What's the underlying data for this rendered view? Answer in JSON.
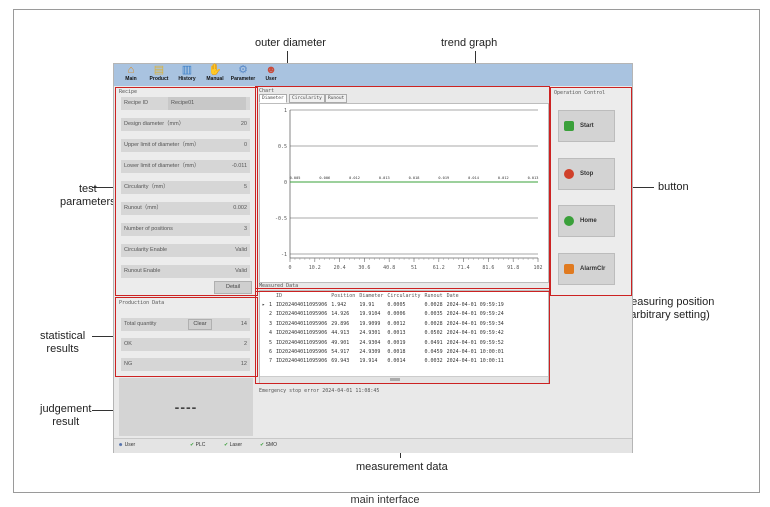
{
  "caption": "main interface",
  "callouts": {
    "outer_diameter": "outer diameter",
    "trend_graph": "trend graph",
    "test_parameters": [
      "test",
      "parameters"
    ],
    "button": "button",
    "measuring_position": [
      "measuring position",
      "(arbitrary setting)"
    ],
    "statistical_results": [
      "statistical",
      "results"
    ],
    "judgement_result": [
      "judgement",
      "result"
    ],
    "measurement_data": "measurement data"
  },
  "toolbar": {
    "items": [
      {
        "label": "Main",
        "icon": "home-icon",
        "glyph": "⌂",
        "color": "#d98a1c"
      },
      {
        "label": "Product",
        "icon": "product-icon",
        "glyph": "▤",
        "color": "#d9b23a"
      },
      {
        "label": "History",
        "icon": "history-icon",
        "glyph": "▥",
        "color": "#3a7fc8"
      },
      {
        "label": "Manual",
        "icon": "manual-icon",
        "glyph": "✋",
        "color": "#c8503a"
      },
      {
        "label": "Parameter",
        "icon": "parameter-icon",
        "glyph": "⚙",
        "color": "#5a8ac8"
      },
      {
        "label": "User",
        "icon": "user-icon",
        "glyph": "☻",
        "color": "#c84a3a"
      }
    ]
  },
  "recipe": {
    "title": "Recipe",
    "rows": [
      {
        "label": "Recipe ID",
        "value": "Recipe01"
      },
      {
        "label": "Design diameter（mm）",
        "value": "20"
      },
      {
        "label": "Upper limit of diameter（mm）",
        "value": "0"
      },
      {
        "label": "Lower limit of diameter（mm）",
        "value": "-0.011"
      },
      {
        "label": "Circularity（mm）",
        "value": "5"
      },
      {
        "label": "Runout（mm）",
        "value": "0.002"
      },
      {
        "label": "Number of positions",
        "value": "3"
      },
      {
        "label": "Circularity Enable",
        "value": "Valid"
      },
      {
        "label": "Runout Enable",
        "value": "Valid"
      }
    ],
    "detail_button": "Detail"
  },
  "production": {
    "title": "Production Data",
    "rows": [
      {
        "label": "Total quantity",
        "value": "14"
      },
      {
        "label": "OK",
        "value": "2"
      },
      {
        "label": "NG",
        "value": "12"
      }
    ],
    "clear_button": "Clear"
  },
  "judgement": {
    "value": "----"
  },
  "chart_panel": {
    "title": "Chart",
    "tabs": [
      "Diameter",
      "Circularity",
      "Runout"
    ],
    "active_tab": 0
  },
  "chart_data": {
    "type": "line",
    "title": "",
    "xlabel": "",
    "ylabel": "",
    "ylim": [
      -1,
      1
    ],
    "yticks": [
      "1",
      "0.5",
      "0",
      "-0.5",
      "-1"
    ],
    "xticks": [
      "0",
      "10.2",
      "20.4",
      "30.6",
      "40.8",
      "51",
      "61.2",
      "71.4",
      "81.6",
      "91.8",
      "102"
    ],
    "xlim": [
      0,
      102
    ],
    "reference_lines": [
      1,
      0.5,
      -0.5,
      -1
    ],
    "series": [
      {
        "x": [
          0,
          102
        ],
        "y": [
          0,
          0
        ],
        "color": "#3aa03a"
      }
    ],
    "point_labels": [
      "0.005",
      "0.006",
      "0.012",
      "0.013",
      "0.018",
      "0.019",
      "0.014",
      "0.012",
      "0.013"
    ]
  },
  "measured": {
    "title": "Measured Data",
    "columns": [
      "",
      "",
      "ID",
      "Position",
      "Diameter",
      "Circularity",
      "Runout",
      "Date"
    ],
    "rows": [
      [
        "▸",
        "1",
        "ID202404011095906",
        "1.942",
        "19.91",
        "0.0005",
        "0.0028",
        "2024-04-01 09:59:19"
      ],
      [
        "",
        "2",
        "ID202404011095906",
        "14.926",
        "19.9104",
        "0.0006",
        "0.0035",
        "2024-04-01 09:59:24"
      ],
      [
        "",
        "3",
        "ID202404011095906",
        "29.896",
        "19.9099",
        "0.0012",
        "0.0028",
        "2024-04-01 09:59:34"
      ],
      [
        "",
        "4",
        "ID202404011095906",
        "44.913",
        "24.9301",
        "0.0013",
        "0.0502",
        "2024-04-01 09:59:42"
      ],
      [
        "",
        "5",
        "ID202404011095906",
        "49.901",
        "24.9304",
        "0.0019",
        "0.0491",
        "2024-04-01 09:59:52"
      ],
      [
        "",
        "6",
        "ID202404011095906",
        "54.917",
        "24.9309",
        "0.0018",
        "0.0459",
        "2024-04-01 10:00:01"
      ],
      [
        "",
        "7",
        "ID202404011095906",
        "69.943",
        "19.914",
        "0.0014",
        "0.0032",
        "2024-04-01 10:00:11"
      ]
    ],
    "message": "Emergency stop error 2024-04-01 11:08:45"
  },
  "operation": {
    "title": "Operation Control",
    "buttons": [
      {
        "label": "Start",
        "icon": "start-icon",
        "color": "#3aa03a"
      },
      {
        "label": "Stop",
        "icon": "stop-icon",
        "color": "#d0402a"
      },
      {
        "label": "Home",
        "icon": "home-position-icon",
        "color": "#3aa03a"
      },
      {
        "label": "AlarmClr",
        "icon": "alarm-clear-icon",
        "color": "#e07a20"
      }
    ]
  },
  "statusbar": {
    "user": "User",
    "items": [
      "PLC",
      "Laser",
      "SMO"
    ],
    "ok_color": "#3aa03a"
  }
}
